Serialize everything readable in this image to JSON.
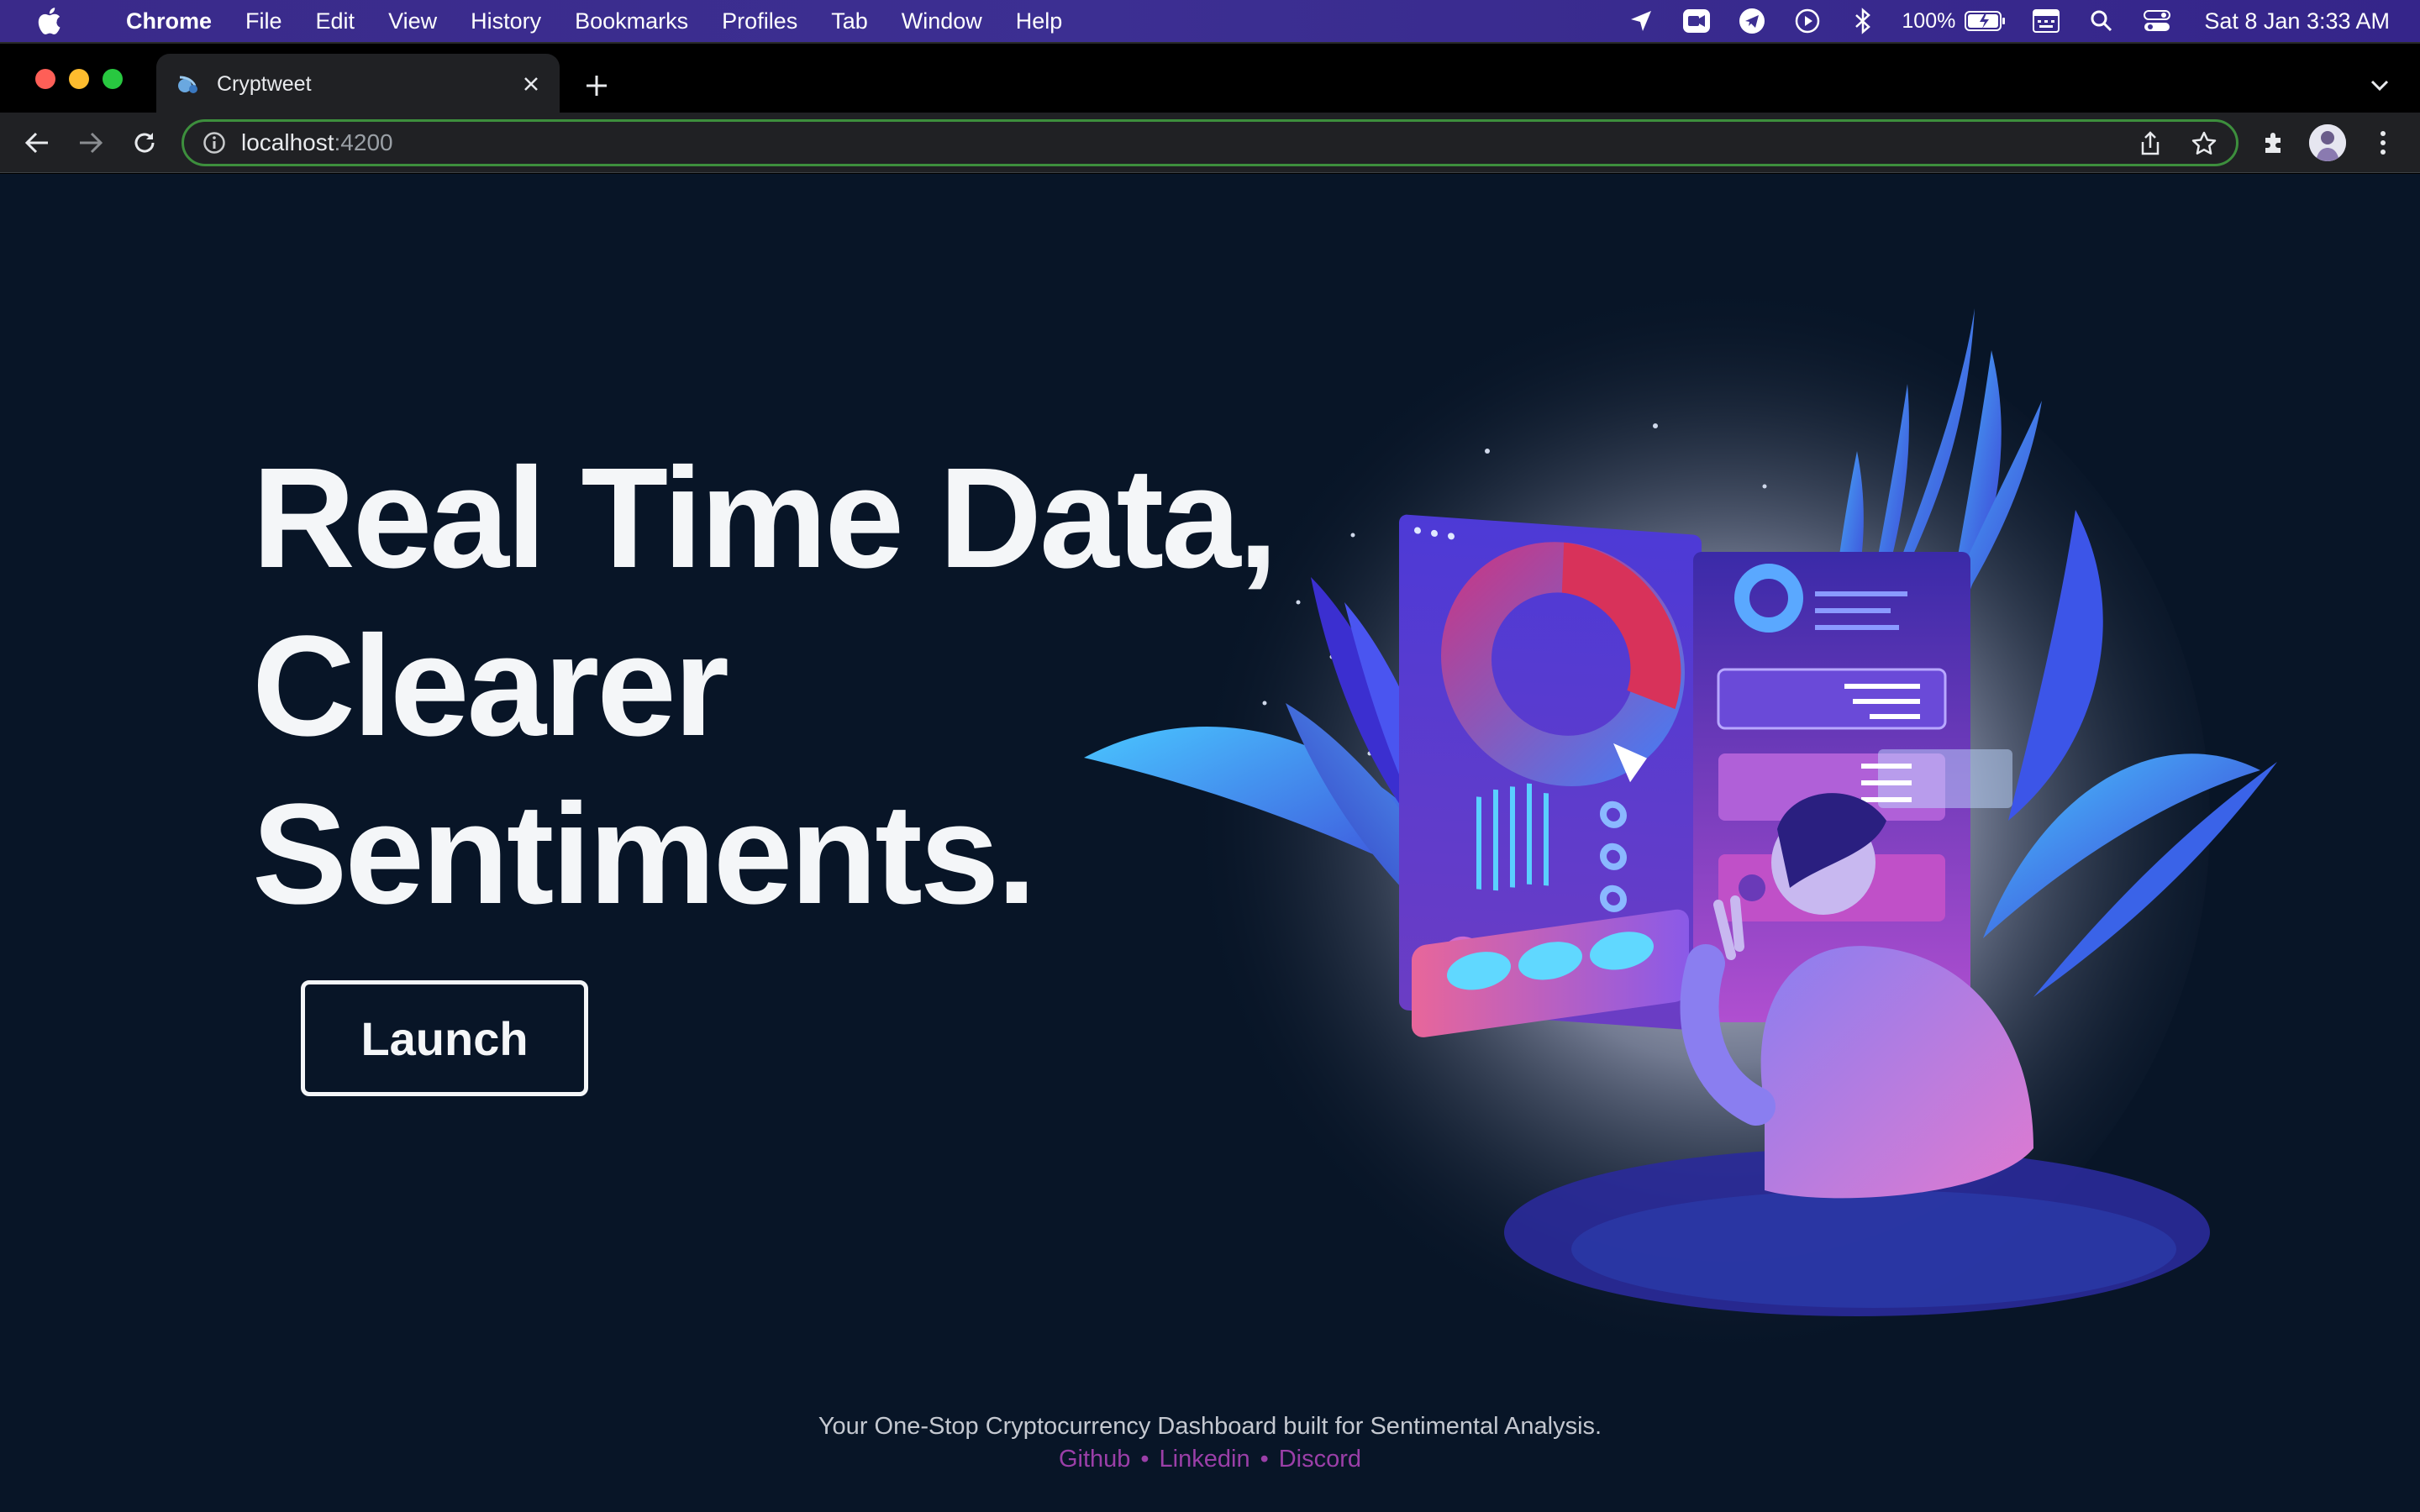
{
  "menubar": {
    "app_name": "Chrome",
    "items": [
      "File",
      "Edit",
      "View",
      "History",
      "Bookmarks",
      "Profiles",
      "Tab",
      "Window",
      "Help"
    ],
    "battery": "100%",
    "clock": "Sat 8 Jan  3:33 AM"
  },
  "browser": {
    "tab_title": "Cryptweet",
    "url_host": "localhost",
    "url_port": ":4200",
    "omnibox_border_color": "#3d8f3d"
  },
  "hero": {
    "line1": "Real Time Data,",
    "line2": "Clearer",
    "line3": "Sentiments.",
    "launch_label": "Launch"
  },
  "footer": {
    "tagline": "Your One-Stop Cryptocurrency Dashboard built for Sentimental Analysis.",
    "links": [
      "Github",
      "Linkedin",
      "Discord"
    ],
    "separator": "•",
    "link_color": "#9b3fa8"
  },
  "colors": {
    "page_bg": "#081527",
    "menubar_bg": "#3c2f92"
  }
}
